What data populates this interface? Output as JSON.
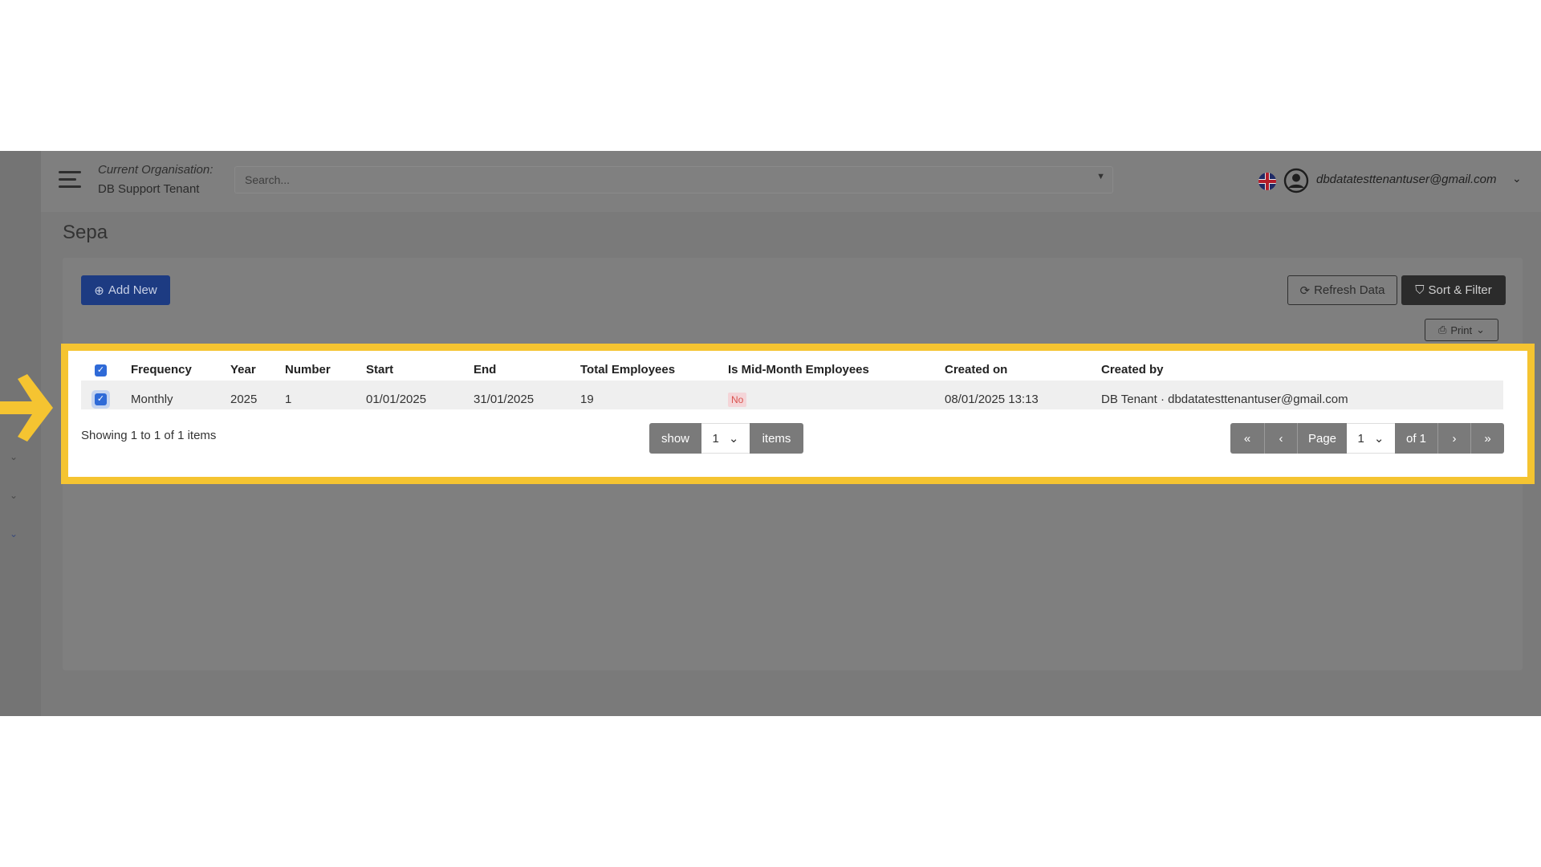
{
  "topbar": {
    "org_label": "Current Organisation:",
    "org_name": "DB Support Tenant",
    "search_placeholder": "Search...",
    "user_email": "dbdatatesttenantuser@gmail.com"
  },
  "page": {
    "title": "Sepa"
  },
  "toolbar": {
    "add_new": "Add New",
    "refresh": "Refresh Data",
    "sort_filter": "Sort & Filter",
    "print": "Print"
  },
  "table": {
    "headers": [
      "Frequency",
      "Year",
      "Number",
      "Start",
      "End",
      "Total Employees",
      "Is Mid-Month Employees",
      "Created on",
      "Created by"
    ],
    "rows": [
      {
        "frequency": "Monthly",
        "year": "2025",
        "number": "1",
        "start": "01/01/2025",
        "end": "31/01/2025",
        "total_employees": "19",
        "is_mid_month": "No",
        "created_on": "08/01/2025 13:13",
        "created_by": "DB Tenant · dbdatatesttenantuser@gmail.com"
      }
    ]
  },
  "footer": {
    "showing": "Showing 1 to 1 of 1 items",
    "show_label": "show",
    "per_page": "1",
    "items_label": "items",
    "page_label": "Page",
    "current_page": "1",
    "of_pages": "of 1"
  },
  "colors": {
    "highlight": "#f5c431",
    "primary": "#1d3b82",
    "badge_no": "#d9534f"
  }
}
